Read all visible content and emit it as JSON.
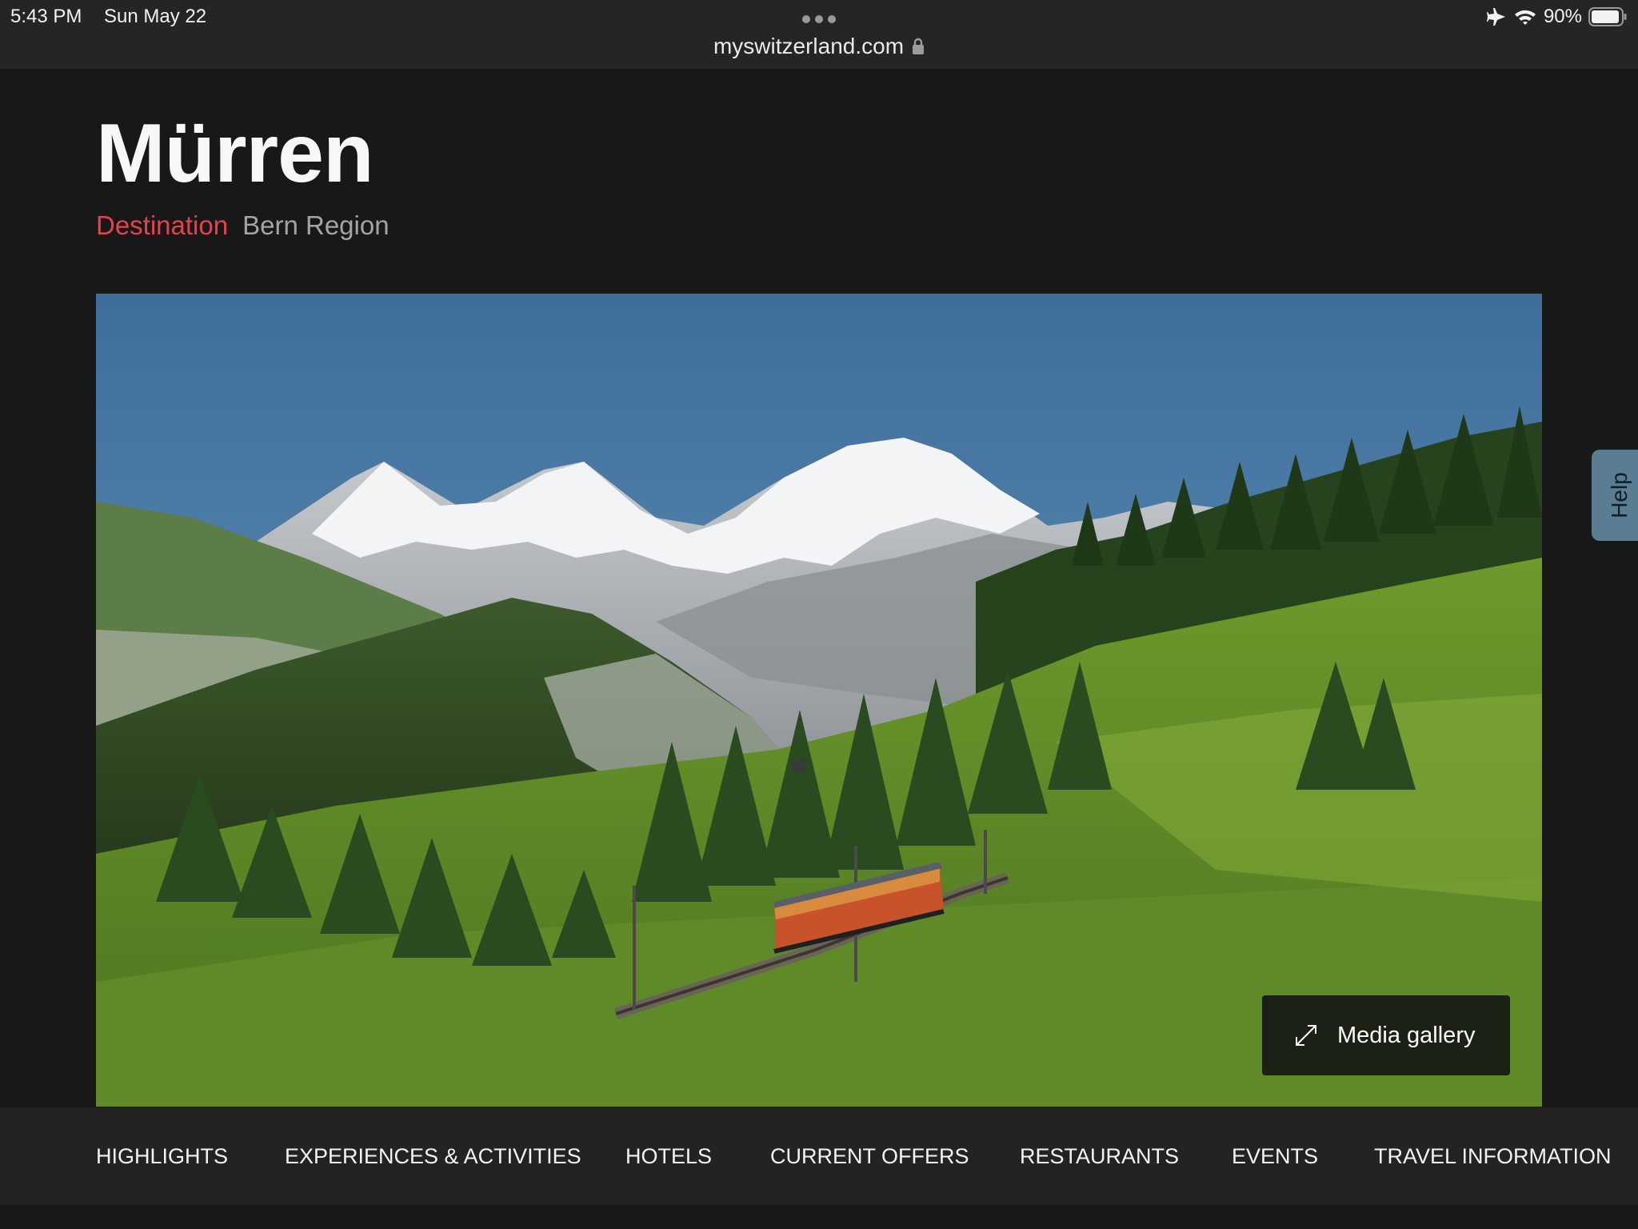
{
  "status_bar": {
    "time": "5:43 PM",
    "date": "Sun May 22",
    "battery": "90%",
    "icons": [
      "airplane-icon",
      "wifi-icon",
      "battery-icon"
    ]
  },
  "browser": {
    "url": "myswitzerland.com",
    "icons": [
      "more-dots-icon",
      "lock-icon"
    ]
  },
  "header": {
    "title": "Mürren",
    "type": "Destination",
    "region": "Bern Region"
  },
  "hero": {
    "media_gallery_label": "Media gallery",
    "icons": [
      "expand-icon"
    ]
  },
  "help": {
    "label": "Help"
  },
  "section_nav": {
    "items": [
      "HIGHLIGHTS",
      "EXPERIENCES & ACTIVITIES",
      "HOTELS",
      "CURRENT OFFERS",
      "RESTAURANTS",
      "EVENTS",
      "TRAVEL INFORMATION"
    ]
  },
  "colors": {
    "background": "#181818",
    "accent": "#e2434f",
    "help_tab": "#5b7d91"
  }
}
